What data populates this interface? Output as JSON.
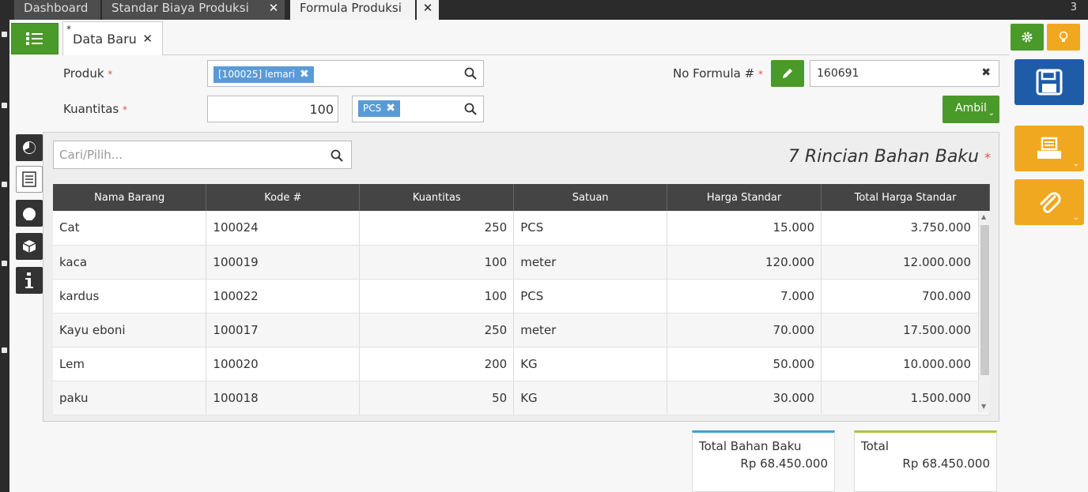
{
  "topbar": {
    "tabs": [
      {
        "label": "Dashboard"
      },
      {
        "label": "Standar Biaya Produksi"
      },
      {
        "label": "Formula Produksi"
      }
    ],
    "count": "3"
  },
  "subtab": {
    "label": "Data Baru"
  },
  "form": {
    "produk_label": "Produk",
    "produk_value": "[100025] lemari",
    "kuantitas_label": "Kuantitas",
    "kuantitas_value": "100",
    "satuan_value": "PCS",
    "noformula_label": "No Formula #",
    "noformula_value": "160691",
    "ambil_label": "Ambil"
  },
  "search": {
    "placeholder": "Cari/Pilih..."
  },
  "section_title": "7 Rincian Bahan Baku",
  "table": {
    "headers": [
      "Nama Barang",
      "Kode #",
      "Kuantitas",
      "Satuan",
      "Harga Standar",
      "Total Harga Standar"
    ],
    "rows": [
      [
        "Cat",
        "100024",
        "250",
        "PCS",
        "15.000",
        "3.750.000"
      ],
      [
        "kaca",
        "100019",
        "100",
        "meter",
        "120.000",
        "12.000.000"
      ],
      [
        "kardus",
        "100022",
        "100",
        "PCS",
        "7.000",
        "700.000"
      ],
      [
        "Kayu eboni",
        "100017",
        "250",
        "meter",
        "70.000",
        "17.500.000"
      ],
      [
        "Lem",
        "100020",
        "200",
        "KG",
        "50.000",
        "10.000.000"
      ],
      [
        "paku",
        "100018",
        "50",
        "KG",
        "30.000",
        "1.500.000"
      ]
    ]
  },
  "totals": {
    "bahan_label": "Total Bahan Baku",
    "bahan_value": "Rp 68.450.000",
    "total_label": "Total",
    "total_value": "Rp 68.450.000"
  },
  "colors": {
    "green": "#4a9a2a",
    "orange": "#f0a820",
    "blue": "#1f5ca8",
    "chip": "#5a9bd5"
  }
}
